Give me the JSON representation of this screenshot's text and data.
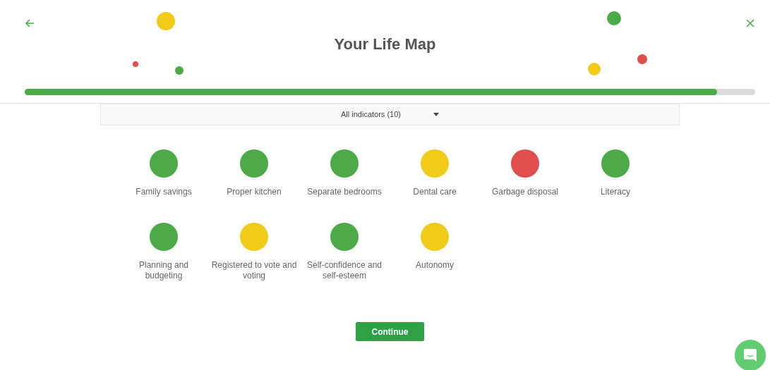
{
  "title": "Your Life Map",
  "progress": {
    "level": 0.948
  },
  "filter": {
    "label": "All indicators (10)"
  },
  "indicators": [
    {
      "label": "Family savings",
      "color": "#4caa47"
    },
    {
      "label": "Proper kitchen",
      "color": "#4caa47"
    },
    {
      "label": "Separate bedrooms",
      "color": "#4caa47"
    },
    {
      "label": "Dental care",
      "color": "#f0cb17"
    },
    {
      "label": "Garbage disposal",
      "color": "#e04e4b"
    },
    {
      "label": "Literacy",
      "color": "#4caa47"
    },
    {
      "label": "Planning and budgeting",
      "color": "#4caa47"
    },
    {
      "label": "Registered to vote and voting",
      "color": "#f0cb17"
    },
    {
      "label": "Self-confidence and self-esteem",
      "color": "#4caa47"
    },
    {
      "label": "Autonomy",
      "color": "#f0cb17"
    }
  ],
  "continue_button": "Continue"
}
